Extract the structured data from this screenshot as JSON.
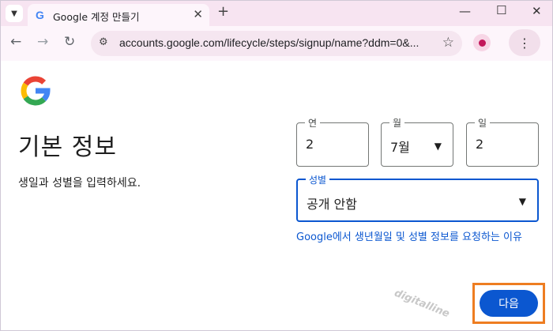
{
  "browser": {
    "tab_title": "Google 계정 만들기",
    "tab_favicon": "G",
    "url": "accounts.google.com/lifecycle/steps/signup/name?ddm=0&...",
    "icons": {
      "tab_search": "chevron-down-icon",
      "close_tab": "close-icon",
      "new_tab": "plus-icon",
      "back": "arrow-left-icon",
      "forward": "arrow-right-icon",
      "reload": "reload-icon",
      "site_info": "tune-icon",
      "bookmark": "star-icon",
      "menu": "more-vertical-icon"
    }
  },
  "page": {
    "title": "기본 정보",
    "subtitle": "생일과 성별을 입력하세요.",
    "fields": {
      "year": {
        "label": "연",
        "value": "2"
      },
      "month": {
        "label": "월",
        "value": "7월"
      },
      "day": {
        "label": "일",
        "value": "2"
      },
      "gender": {
        "label": "성별",
        "value": "공개 안함"
      }
    },
    "help_link": "Google에서 생년월일 및 성별 정보를 요청하는 이유",
    "next_button": "다음",
    "watermark": "digitalline"
  },
  "colors": {
    "primary": "#0b57d0",
    "highlight_box": "#ee7d21",
    "tabstrip": "#f7e4f1"
  }
}
